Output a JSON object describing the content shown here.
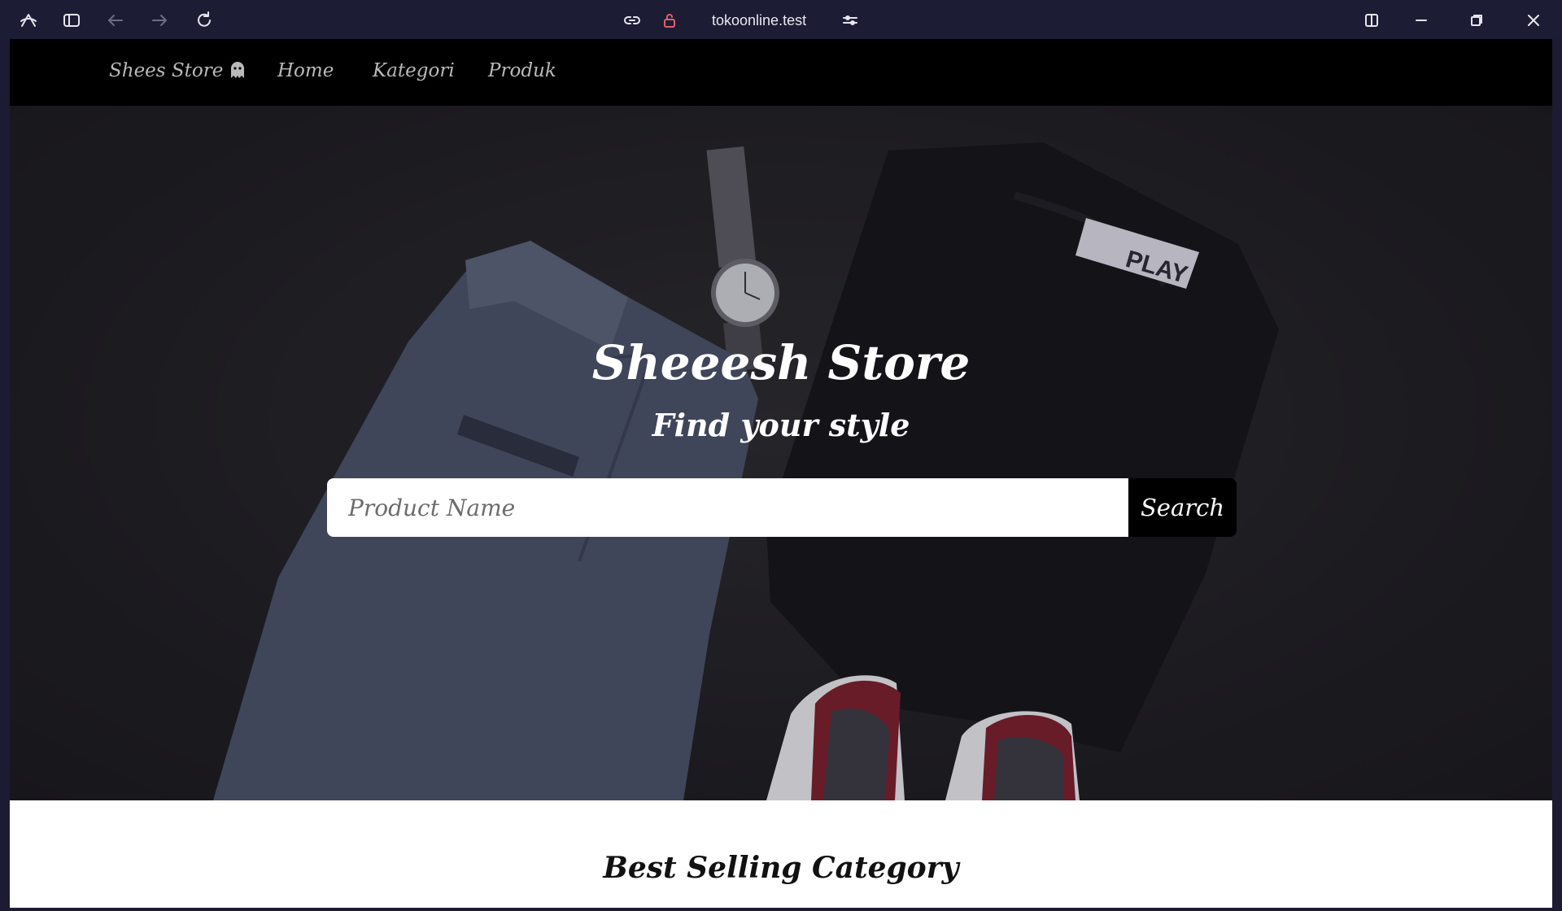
{
  "browser": {
    "url": "tokoonline.test",
    "icons": [
      "arc-logo-icon",
      "sidebar-toggle-icon",
      "back-arrow-icon",
      "forward-arrow-icon",
      "reload-icon",
      "copy-link-icon",
      "lock-icon",
      "site-settings-icon",
      "split-view-icon",
      "minimize-icon",
      "restore-icon",
      "close-icon"
    ]
  },
  "navbar": {
    "brand": "Shees Store",
    "links": [
      "Home",
      "Kategori",
      "Produk"
    ]
  },
  "hero": {
    "title": "Sheeesh Store",
    "subtitle": "Find your style",
    "search_placeholder": "Product Name",
    "search_button": "Search"
  },
  "section": {
    "title": "Best Selling Category"
  },
  "colors": {
    "navbar_bg": "#000000",
    "chrome_bg": "#1d1c35",
    "button_bg": "#000000"
  }
}
